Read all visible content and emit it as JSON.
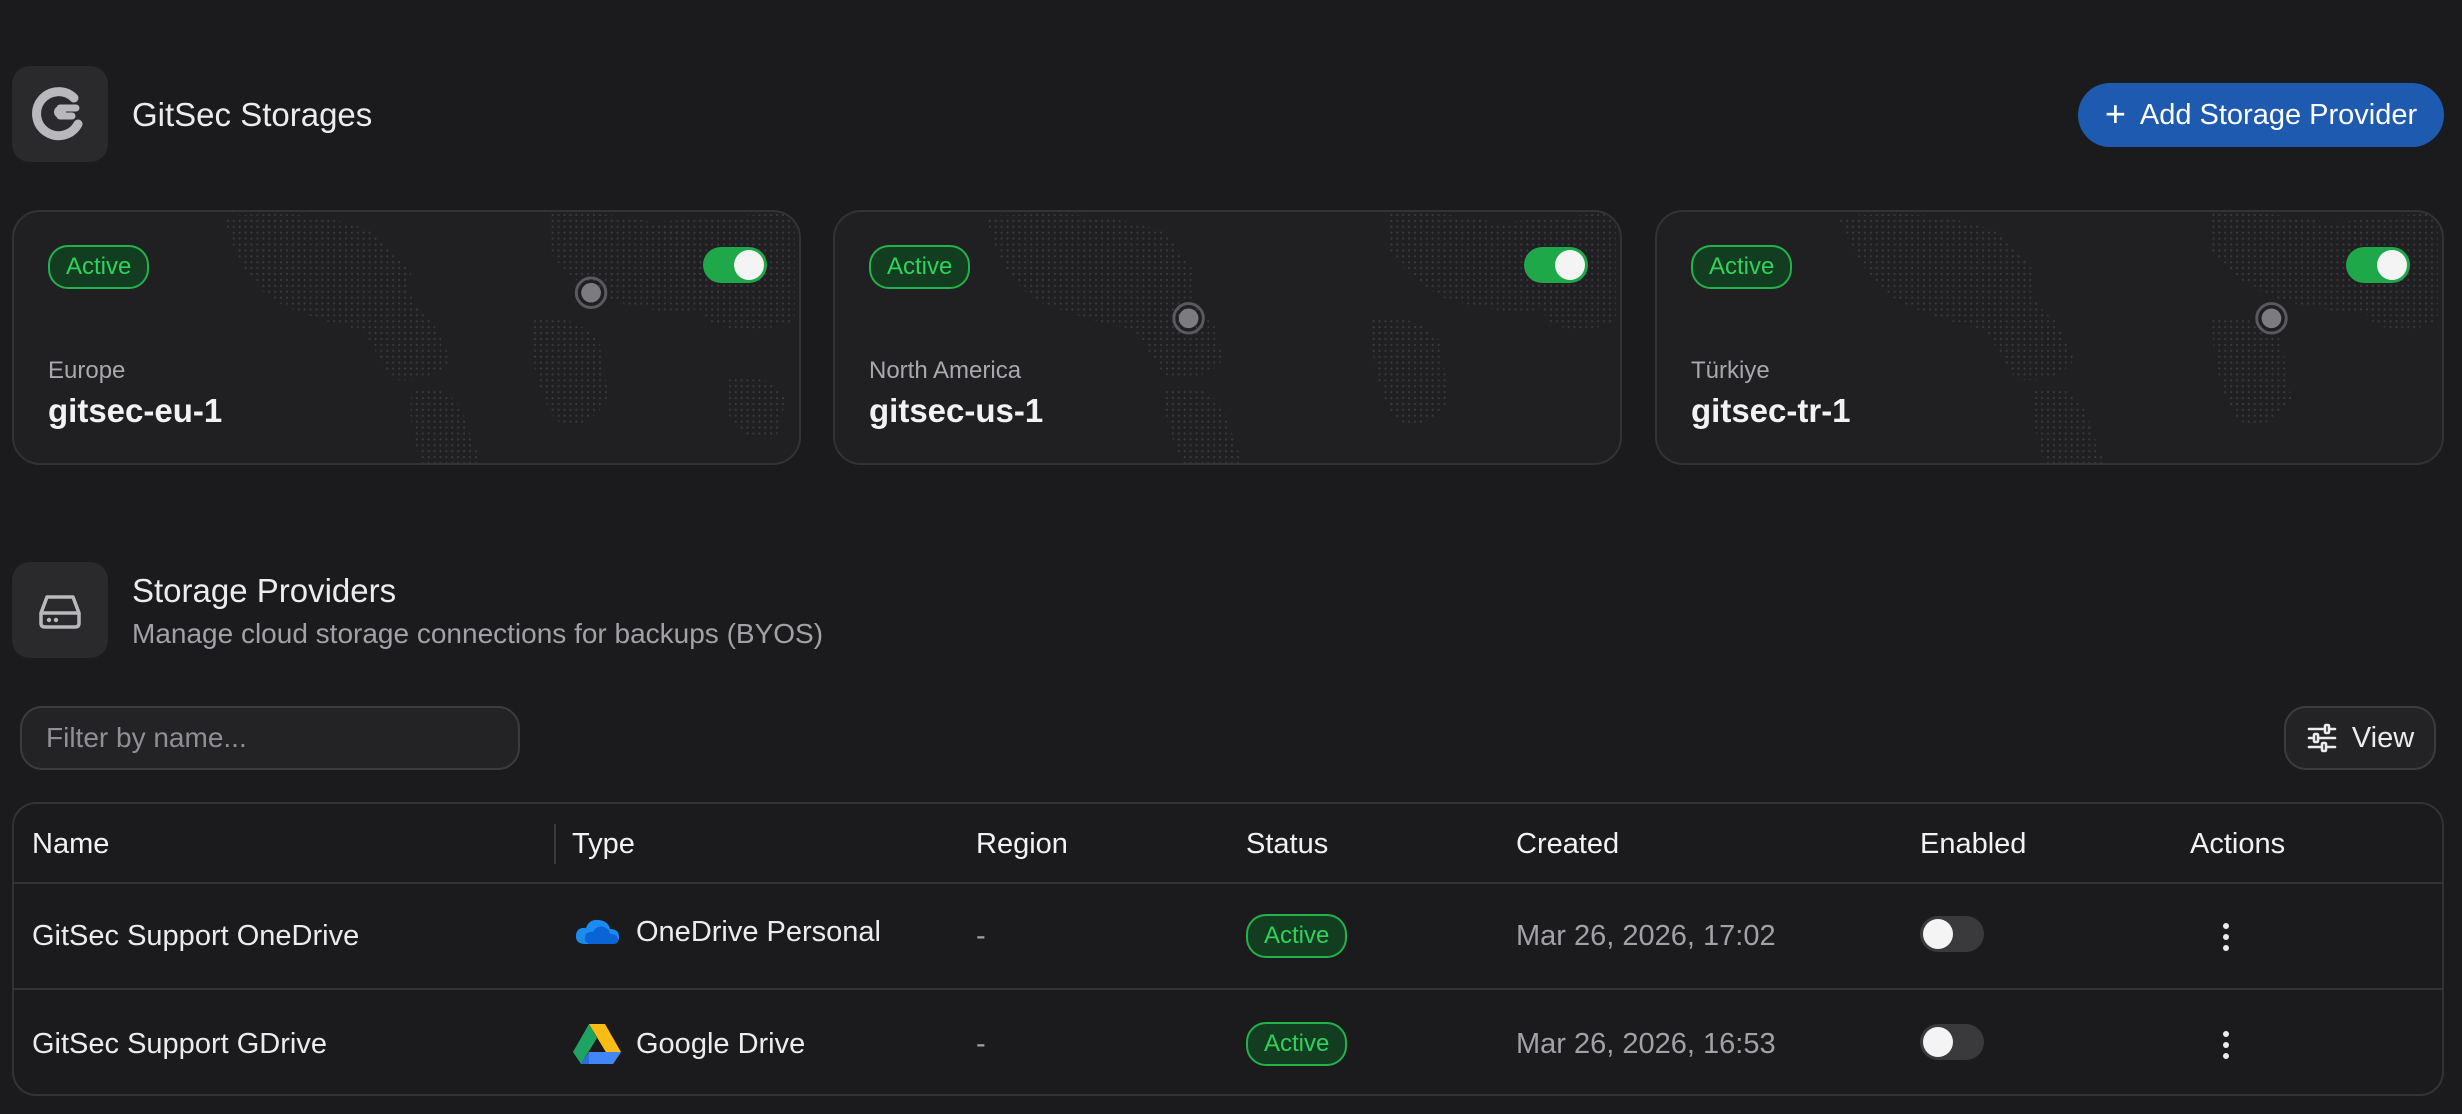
{
  "header": {
    "title": "GitSec Storages",
    "add_button_label": "Add Storage Provider",
    "add_button_icon": "plus-icon"
  },
  "storages": [
    {
      "status": "Active",
      "region": "Europe",
      "name": "gitsec-eu-1",
      "enabled": true
    },
    {
      "status": "Active",
      "region": "North America",
      "name": "gitsec-us-1",
      "enabled": true
    },
    {
      "status": "Active",
      "region": "Türkiye",
      "name": "gitsec-tr-1",
      "enabled": true
    }
  ],
  "providers_section": {
    "title": "Storage Providers",
    "subtitle": "Manage cloud storage connections for backups (BYOS)",
    "icon": "hard-drive-icon"
  },
  "toolbar": {
    "filter_placeholder": "Filter by name...",
    "view_label": "View",
    "view_icon": "sliders-icon"
  },
  "table": {
    "columns": [
      "Name",
      "Type",
      "Region",
      "Status",
      "Created",
      "Enabled",
      "Actions"
    ],
    "rows": [
      {
        "name": "GitSec Support OneDrive",
        "type": "OneDrive Personal",
        "type_icon": "onedrive-icon",
        "region": "-",
        "status": "Active",
        "created": "Mar 26, 2026, 17:02",
        "enabled": false
      },
      {
        "name": "GitSec Support GDrive",
        "type": "Google Drive",
        "type_icon": "google-drive-icon",
        "region": "-",
        "status": "Active",
        "created": "Mar 26, 2026, 16:53",
        "enabled": false
      }
    ]
  },
  "colors": {
    "background": "#1b1b1d",
    "accent": "#1e5bb0",
    "active_green": "#2fd25b",
    "toggle_on": "#1ea84a"
  }
}
